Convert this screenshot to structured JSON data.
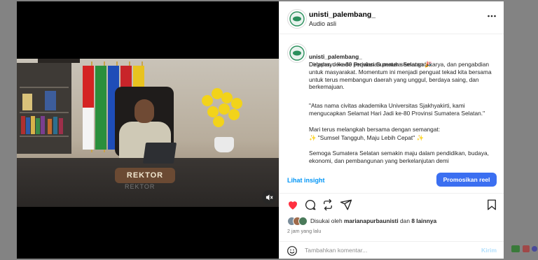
{
  "post": {
    "author": "unisti_palembang_",
    "audio": "Audio asli",
    "nameplate": "REKTOR",
    "nameplate_reflection": "REKTOR"
  },
  "caption": {
    "author": "unisti_palembang_",
    "title": "Dirgahayu ke-80 Provinsi Sumatera Selatan 🎉",
    "p1": "Delapan dekade perjalanan penuh semangat, karya, dan pengabdian untuk masyarakat. Momentum ini menjadi penguat tekad kita bersama untuk terus membangun daerah yang unggul, berdaya saing, dan berkemajuan.",
    "p2": "\"Atas nama civitas akademika Universitas Sjakhyakirti, kami mengucapkan Selamat Hari Jadi ke-80 Provinsi Sumatera Selatan.\"",
    "p3": "Mari terus melangkah bersama dengan semangat:",
    "p3b": "✨ \"Sumsel Tangguh, Maju Lebih Cepat\" ✨",
    "p4": "Semoga Sumatera Selatan semakin maju dalam pendidikan, budaya, ekonomi, dan pembangunan yang berkelanjutan demi"
  },
  "insight": {
    "link": "Lihat insight",
    "promo_button": "Promosikan reel"
  },
  "likes": {
    "prefix": "Disukai oleh ",
    "user": "marianapurbaunisti",
    "middle": " dan ",
    "others": "8 lainnya"
  },
  "time": "2 jam yang lalu",
  "comment": {
    "placeholder": "Tambahkan komentar...",
    "send": "Kirim"
  },
  "colors": {
    "like_red": "#ff3040",
    "link_blue": "#0095f6",
    "promo_blue": "#3b6ff1"
  },
  "icons": [
    "more-icon",
    "mute-icon",
    "heart-icon",
    "comment-icon",
    "repost-icon",
    "share-icon",
    "save-icon",
    "emoji-icon"
  ]
}
